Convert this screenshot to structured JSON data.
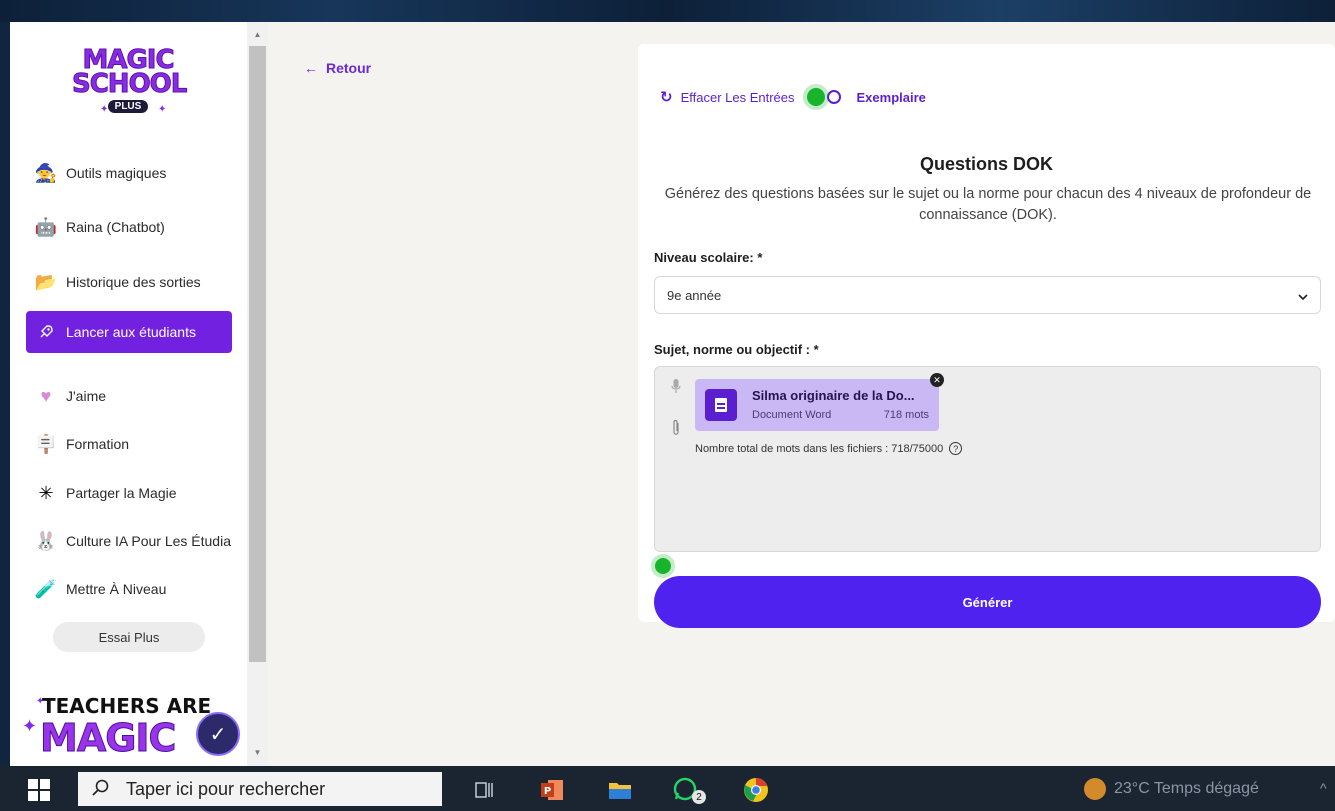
{
  "sidebar": {
    "logo": {
      "line1": "MAGIC",
      "line2": "SCHOOL",
      "badge": "PLUS"
    },
    "items": [
      {
        "label": "Outils magiques",
        "icon": "wand-icon"
      },
      {
        "label": "Raina (Chatbot)",
        "icon": "robot-icon"
      },
      {
        "label": "Historique des sorties",
        "icon": "folder-icon"
      },
      {
        "label": "Lancer aux étudiants",
        "icon": "rocket-icon"
      },
      {
        "label": "J'aime",
        "icon": "heart-icon"
      },
      {
        "label": "Formation",
        "icon": "easel-icon"
      },
      {
        "label": "Partager la Magie",
        "icon": "sparkle-icon"
      },
      {
        "label": "Culture IA Pour Les Étudia",
        "icon": "bunny-icon"
      },
      {
        "label": "Mettre À Niveau",
        "icon": "potion-icon"
      }
    ],
    "trial_button": "Essai Plus",
    "promo": {
      "line1": "TEACHERS ARE",
      "line2": "MAGIC"
    }
  },
  "main": {
    "back_label": "Retour",
    "toolbar": {
      "clear_label": "Effacer Les Entrées",
      "example_label": "Exemplaire"
    },
    "title": "Questions DOK",
    "subtitle": "Générez des questions basées sur le sujet ou la norme pour chacun des 4 niveaux de profondeur de connaissance (DOK).",
    "grade": {
      "label": "Niveau scolaire: *",
      "value": "9e année"
    },
    "topic": {
      "label": "Sujet, norme ou objectif : *",
      "file": {
        "name": "Silma originaire de la Do...",
        "type": "Document Word",
        "words": "718 mots"
      },
      "word_count": "Nombre total de mots dans les fichiers : 718/75000"
    },
    "generate_label": "Générer"
  },
  "taskbar": {
    "search_placeholder": "Taper ici pour rechercher",
    "whatsapp_badge": "2",
    "weather": "23°C  Temps dégagé"
  }
}
